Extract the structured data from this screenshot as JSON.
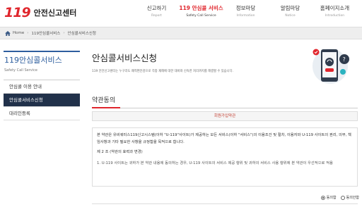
{
  "header": {
    "logo_mark": "119",
    "logo_text": "안전신고센터",
    "nav": [
      {
        "ko": "신고하기",
        "en": "Report"
      },
      {
        "ko": "119 안심콜 서비스",
        "en": "Safety Call Service"
      },
      {
        "ko": "정보마당",
        "en": "Information"
      },
      {
        "ko": "알림마당",
        "en": "Notice"
      },
      {
        "ko": "홈페이지소개",
        "en": "Introduction"
      }
    ]
  },
  "breadcrumb": {
    "home": "Home",
    "level1": "119안심콜서비스",
    "level2": "안심콜서비스신청"
  },
  "sidebar": {
    "title": "119안심콜서비스",
    "subtitle": "Safety Call Service",
    "items": [
      {
        "label": "안심콜 이용 안내"
      },
      {
        "label": "안심콜서비스신청"
      },
      {
        "label": "대리인등록"
      }
    ]
  },
  "main": {
    "title": "안심콜서비스신청",
    "description": "119 안전신고센터는 누구라도 쾌적편안감으로 각종 재해에 대한 대비와 신속한 처리까지를 해결할 수 있습니다."
  },
  "terms": {
    "section_title": "약관동의",
    "head": "회원가입약관",
    "para1": "본 약관은 유비쿼터스119신고시스템(이하 \"U-119\"사이트)가 제공하는 모든 서비스(이하 \"서비스\")의 이용조건 및 절차, 이용자와 U-119 사이트의 권리, 의무, 책임사항과 기타 필요한 사항을 규정함을 목적으로 합니다.",
    "article": "제 2 조 (약관의 효력과 변경)",
    "item1": "1. U-119 사이트는 귀하가 본 약관 내용에 동의하는 경우, U-119 사이트의 서비스 제공 행위 및 귀하의 서비스 사용 행위에 본 약관이 우선적으로 적용"
  },
  "agree": {
    "agree_label": "동의함",
    "disagree_label": "동의안함"
  },
  "colors": {
    "brand_red": "#e0262d",
    "sidebar_active": "#21314a",
    "side_title_blue": "#2d5e9e"
  }
}
